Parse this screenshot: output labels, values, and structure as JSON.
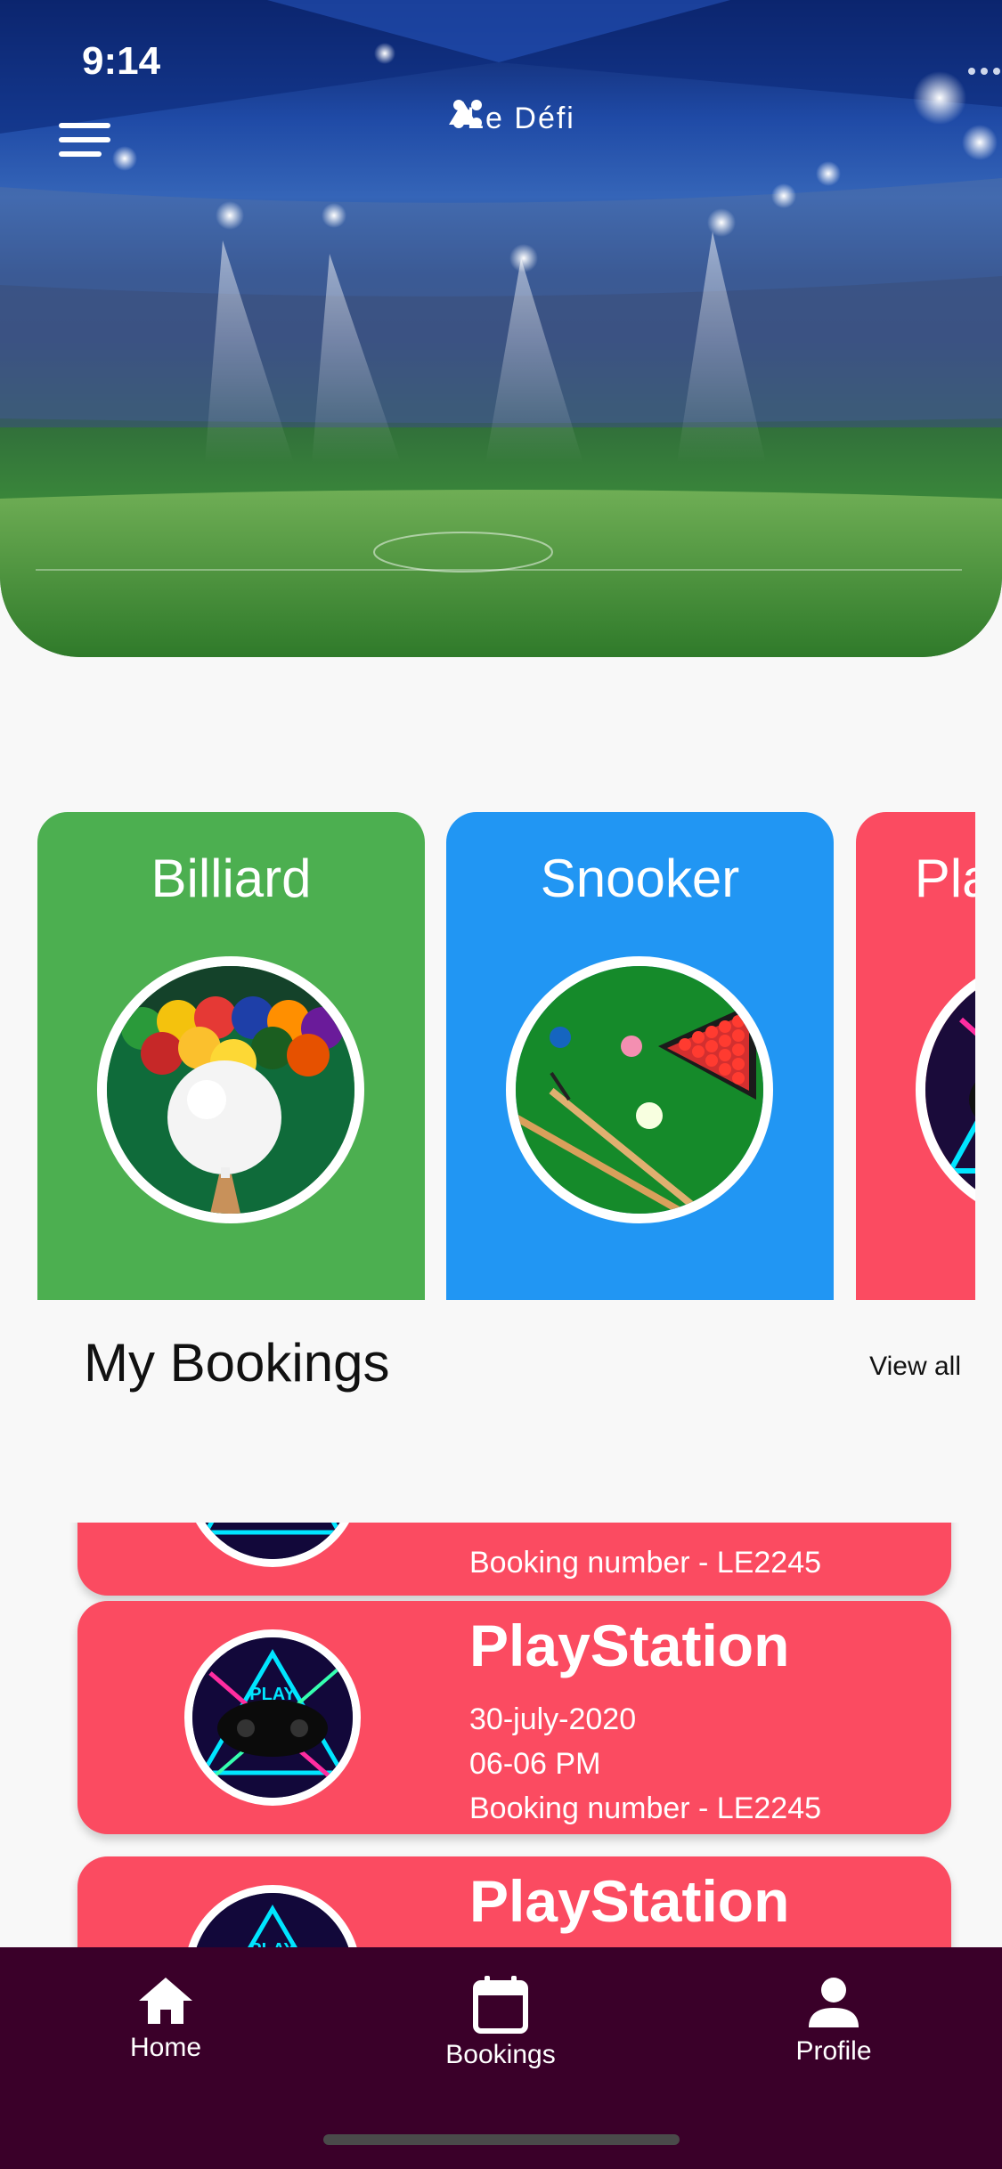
{
  "status_bar": {
    "time": "9:14",
    "icons": [
      "cellular-icon",
      "wifi-icon",
      "battery-icon"
    ]
  },
  "header": {
    "logo_text": "Le Défi",
    "menu_icon": "hamburger-menu-icon"
  },
  "categories": [
    {
      "label": "Billiard",
      "color": "#4caf50",
      "image": "billiard-balls-image"
    },
    {
      "label": "Snooker",
      "color": "#2196f3",
      "image": "snooker-table-image"
    },
    {
      "label": "PlayStation",
      "color": "#fb4b61",
      "image": "gamepad-image"
    }
  ],
  "bookings_section": {
    "title": "My Bookings",
    "view_all": "View all",
    "items": [
      {
        "name": "",
        "date": "",
        "time": "",
        "number": "Booking number - LE2245",
        "image": "gamepad-image"
      },
      {
        "name": "PlayStation",
        "date": "30-july-2020",
        "time": "06-06 PM",
        "number": "Booking number - LE2245",
        "image": "gamepad-image"
      },
      {
        "name": "PlayStation",
        "date": "",
        "time": "",
        "number": "",
        "image": "gamepad-image"
      }
    ]
  },
  "bottom_nav": {
    "items": [
      {
        "label": "Home",
        "icon": "home-icon"
      },
      {
        "label": "Bookings",
        "icon": "calendar-icon"
      },
      {
        "label": "Profile",
        "icon": "person-icon"
      }
    ]
  },
  "colors": {
    "accent_pink": "#fb4b61",
    "billiard_green": "#4caf50",
    "snooker_blue": "#2196f3",
    "nav_background": "#3a0029"
  }
}
